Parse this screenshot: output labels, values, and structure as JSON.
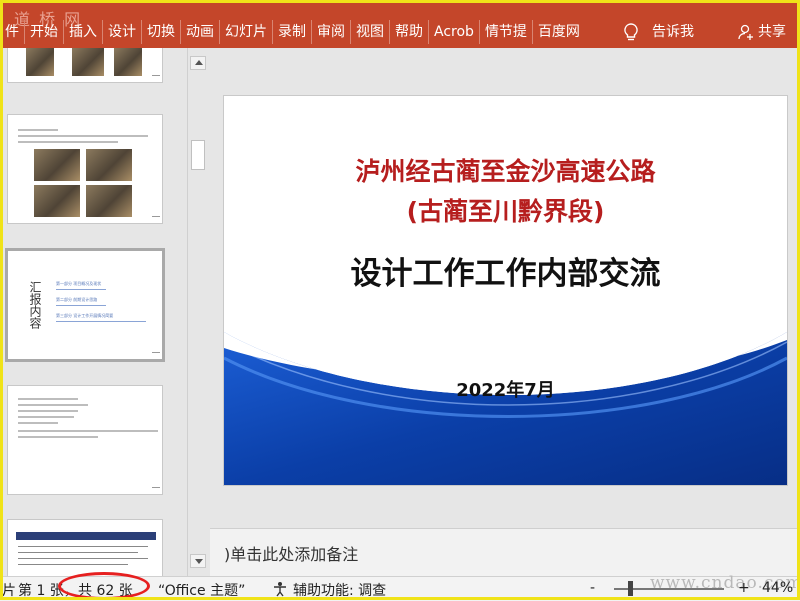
{
  "ribbon": {
    "watermark": "道 桥 网",
    "tabs": [
      "件",
      "开始",
      "插入",
      "设计",
      "切换",
      "动画",
      "幻灯片",
      "录制",
      "审阅",
      "视图",
      "帮助",
      "Acrob",
      "情节提",
      "百度网"
    ],
    "tell_me": "告诉我",
    "share": "共享",
    "color": "#c4462a"
  },
  "thumbnail_pane": {
    "slide2_text": "汇报内容",
    "slide2_items": [
      "第一部分 项目概况及现状",
      "第二部分 前期设计思路",
      "第三部分 设计工作开展情况简要"
    ]
  },
  "slide": {
    "title_line1": "泸州经古蔺至金沙高速公路",
    "title_line2": "(古蔺至川黔界段)",
    "subtitle": "设计工作工作内部交流",
    "date": "2022年7月",
    "title_color": "#b61e1e",
    "wave_color": "#0b3fa8"
  },
  "notes": {
    "placeholder": ")单击此处添加备注"
  },
  "status": {
    "slide_prefix": "片",
    "slide_pos": "第 1 张，",
    "slide_total": "共 62 张",
    "theme": "“Office 主题”",
    "accessibility": "辅助功能: 调查",
    "zoom_minus": "-",
    "zoom_plus": "+",
    "zoom": "44%",
    "watermark": "www.cndao.com"
  }
}
